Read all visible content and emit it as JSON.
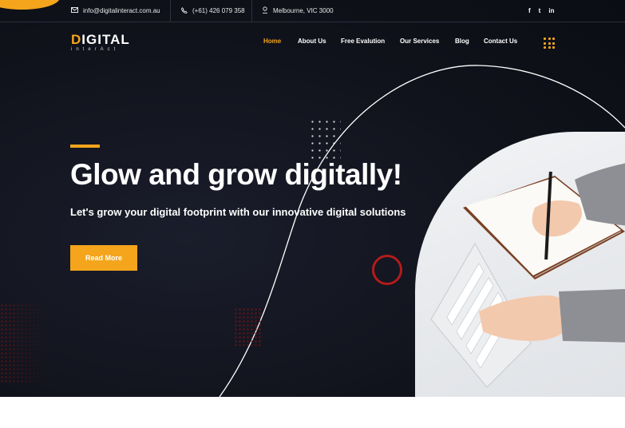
{
  "topbar": {
    "email": "info@digitalinteract.com.au",
    "phone": "(+61) 426 079 358",
    "address": "Melbourne, VIC 3000",
    "social": [
      "f",
      "t",
      "in"
    ]
  },
  "logo": {
    "accent_letter": "D",
    "main_rest": "IGITAL",
    "sub": "interAct"
  },
  "nav": {
    "items": [
      "Home",
      "About Us",
      "Free Evalution",
      "Our Services",
      "Blog",
      "Contact Us"
    ],
    "active": "Home"
  },
  "hero": {
    "headline": "Glow and grow digitally!",
    "subline": "Let's grow your digital footprint with our innovative digital solutions",
    "cta_label": "Read More"
  },
  "colors": {
    "accent": "#f4a51c",
    "background": "#11131c",
    "ring": "#b51b1b"
  }
}
